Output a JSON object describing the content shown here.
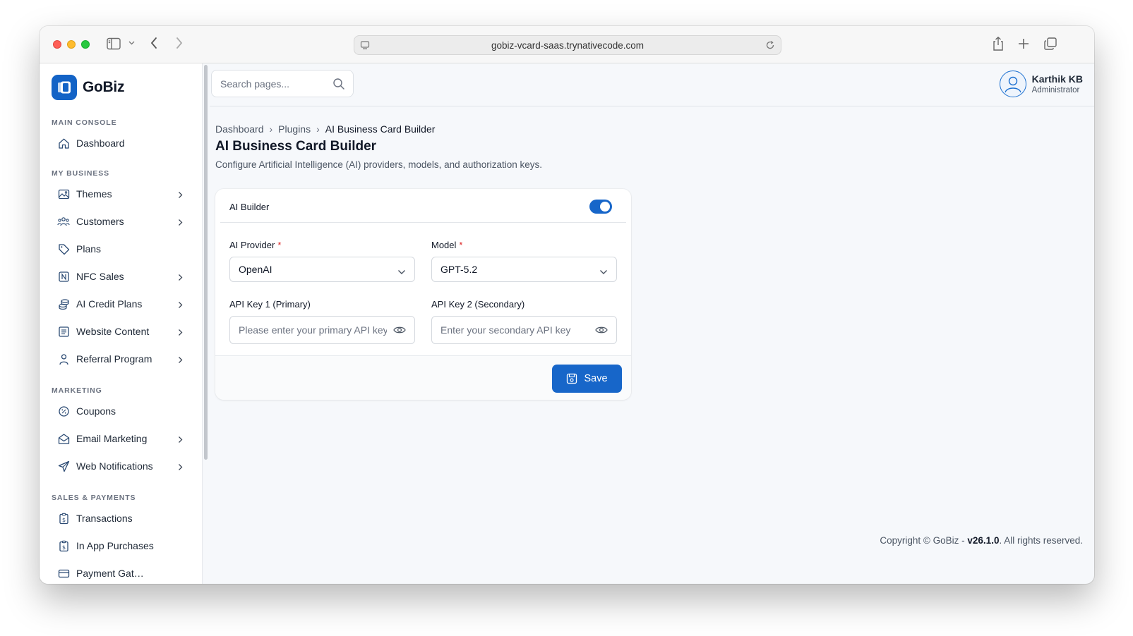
{
  "browser": {
    "url": "gobiz-vcard-saas.trynativecode.com"
  },
  "brand": {
    "name": "GoBiz",
    "accent": "#1766c9"
  },
  "sidebar": {
    "sections": [
      {
        "label": "MAIN CONSOLE",
        "items": [
          {
            "label": "Dashboard",
            "icon": "home-icon",
            "has_submenu": false
          }
        ]
      },
      {
        "label": "MY BUSINESS",
        "items": [
          {
            "label": "Themes",
            "icon": "image-icon",
            "has_submenu": true
          },
          {
            "label": "Customers",
            "icon": "users-icon",
            "has_submenu": true
          },
          {
            "label": "Plans",
            "icon": "tag-icon",
            "has_submenu": false
          },
          {
            "label": "NFC Sales",
            "icon": "nfc-icon",
            "has_submenu": true
          },
          {
            "label": "AI Credit Plans",
            "icon": "coins-icon",
            "has_submenu": true
          },
          {
            "label": "Website Content",
            "icon": "document-icon",
            "has_submenu": true
          },
          {
            "label": "Referral Program",
            "icon": "person-icon",
            "has_submenu": true
          }
        ]
      },
      {
        "label": "MARKETING",
        "items": [
          {
            "label": "Coupons",
            "icon": "percent-icon",
            "has_submenu": false
          },
          {
            "label": "Email Marketing",
            "icon": "mail-icon",
            "has_submenu": true
          },
          {
            "label": "Web Notifications",
            "icon": "send-icon",
            "has_submenu": true
          }
        ]
      },
      {
        "label": "SALES & PAYMENTS",
        "items": [
          {
            "label": "Transactions",
            "icon": "receipt-icon",
            "has_submenu": false
          },
          {
            "label": "In App Purchases",
            "icon": "receipt-icon",
            "has_submenu": false
          },
          {
            "label": "Payment Gat…",
            "icon": "card-icon",
            "has_submenu": false
          }
        ]
      }
    ]
  },
  "header": {
    "search_placeholder": "Search pages...",
    "user": {
      "name": "Karthik KB",
      "role": "Administrator"
    }
  },
  "page": {
    "breadcrumb": [
      "Dashboard",
      "Plugins",
      "AI Business Card Builder"
    ],
    "title": "AI Business Card Builder",
    "description": "Configure Artificial Intelligence (AI) providers, models, and authorization keys."
  },
  "form": {
    "toggle_label": "AI Builder",
    "toggle_on": true,
    "provider_label": "AI Provider",
    "provider_value": "OpenAI",
    "model_label": "Model",
    "model_value": "GPT-5.2",
    "required_mark": "*",
    "key1_label": "API Key 1 (Primary)",
    "key1_placeholder": "Please enter your primary API key",
    "key2_label": "API Key 2 (Secondary)",
    "key2_placeholder": "Enter your secondary API key",
    "save_label": "Save"
  },
  "footer": {
    "prefix": "Copyright © GoBiz - ",
    "version": "v26.1.0",
    "suffix": ". All rights reserved."
  }
}
